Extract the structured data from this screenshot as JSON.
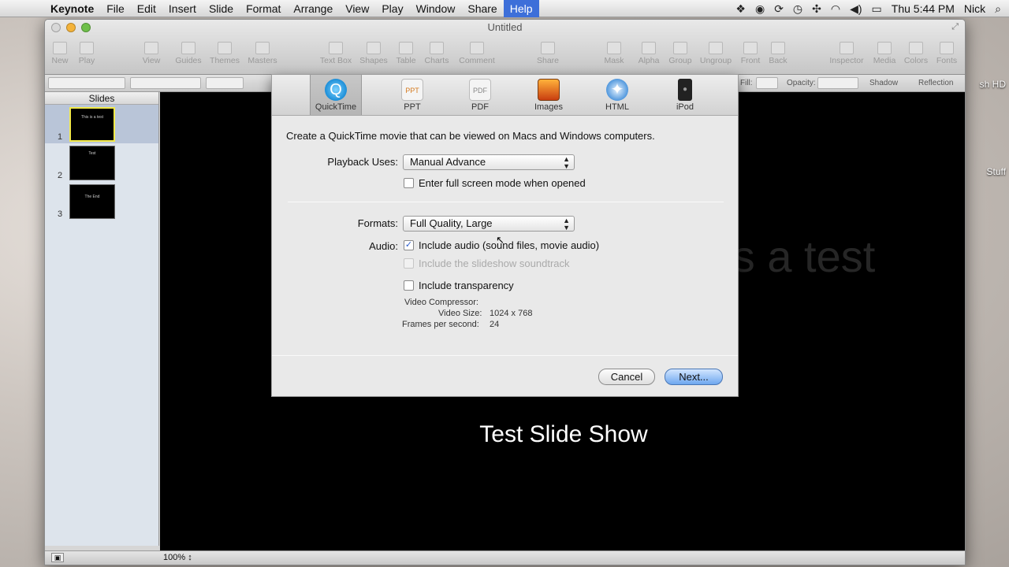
{
  "menubar": {
    "app": "Keynote",
    "items": [
      "File",
      "Edit",
      "Insert",
      "Slide",
      "Format",
      "Arrange",
      "View",
      "Play",
      "Window",
      "Share",
      "Help"
    ],
    "active": "Help",
    "clock": "Thu 5:44 PM",
    "user": "Nick"
  },
  "desktop": {
    "label1": "sh HD",
    "label2": "Stuff"
  },
  "window": {
    "title": "Untitled",
    "toolbar": [
      "New",
      "Play",
      "View",
      "Guides",
      "Themes",
      "Masters",
      "Text Box",
      "Shapes",
      "Table",
      "Charts",
      "Comment",
      "Share",
      "Mask",
      "Alpha",
      "Group",
      "Ungroup",
      "Front",
      "Back",
      "Inspector",
      "Media",
      "Colors",
      "Fonts"
    ],
    "formatbar": {
      "fill_label": "Fill:",
      "opacity_label": "Opacity:",
      "shadow_label": "Shadow",
      "reflection_label": "Reflection"
    },
    "navigator": {
      "header": "Slides",
      "slides": [
        {
          "num": "1",
          "text": "This is a test"
        },
        {
          "num": "2",
          "text": "Test"
        },
        {
          "num": "3",
          "text": "The End"
        }
      ]
    },
    "slide": {
      "faded_text": "This is a test",
      "title": "Test Slide Show"
    },
    "zoom": "100%"
  },
  "sheet": {
    "tabs": [
      "QuickTime",
      "PPT",
      "PDF",
      "Images",
      "HTML",
      "iPod"
    ],
    "active_tab": "QuickTime",
    "description": "Create a QuickTime movie that can be viewed on Macs and Windows computers.",
    "playback_label": "Playback Uses:",
    "playback_value": "Manual Advance",
    "fullscreen_label": "Enter full screen mode when opened",
    "formats_label": "Formats:",
    "formats_value": "Full Quality, Large",
    "audio_label": "Audio:",
    "include_audio_label": "Include audio (sound files, movie audio)",
    "include_soundtrack_label": "Include the slideshow soundtrack",
    "include_transparency_label": "Include transparency",
    "video_compressor_label": "Video Compressor:",
    "video_size_label": "Video Size:",
    "video_size_value": "1024 x 768",
    "fps_label": "Frames per second:",
    "fps_value": "24",
    "cancel_label": "Cancel",
    "next_label": "Next..."
  },
  "colors": {
    "accent": "#3d6fd9",
    "default_button": "#6ea7ef"
  }
}
